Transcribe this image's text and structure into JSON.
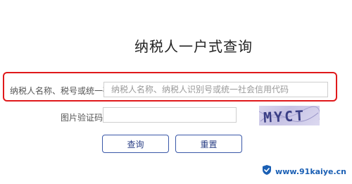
{
  "page": {
    "title": "纳税人一户式查询"
  },
  "form": {
    "taxpayer_label": "纳税人名称、税号或统一码：",
    "taxpayer_placeholder": "纳税人名称、纳税人识别号或统一社会信用代码",
    "taxpayer_value": "",
    "captcha_label": "图片验证码：",
    "captcha_placeholder": "",
    "captcha_value": "",
    "captcha_image_text": "MYCT"
  },
  "buttons": {
    "query_label": "查询",
    "reset_label": "重置"
  },
  "watermark": {
    "text": "www.91kaiye.cn"
  },
  "colors": {
    "highlight": "#e0191b",
    "button_border": "#3a58a8",
    "watermark": "#1a5fb4"
  }
}
